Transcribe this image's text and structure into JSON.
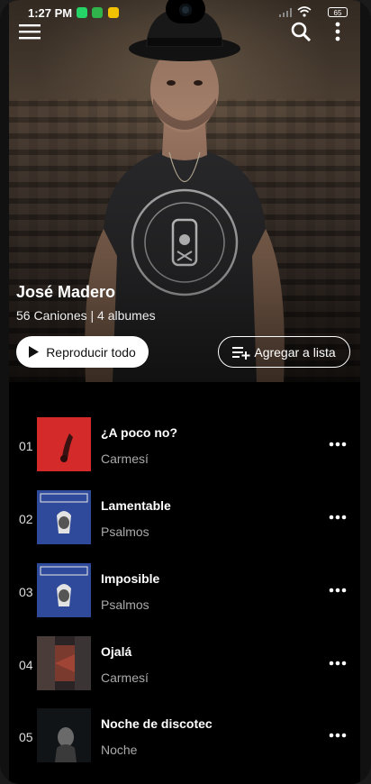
{
  "status_bar": {
    "time": "1:27 PM",
    "battery": "65"
  },
  "artist": {
    "name": "José Madero",
    "meta": "56 Caniones | 4 albumes"
  },
  "actions": {
    "play_all_label": "Reproducir todo",
    "add_to_list_label": "Agregar a lista"
  },
  "icons": {
    "menu": "hamburger-menu-icon",
    "search": "search-icon",
    "overflow": "more-vertical-icon",
    "play": "play-icon",
    "playlist_add": "playlist-add-icon",
    "track_more": "more-horizontal-icon"
  },
  "colors": {
    "accent_red": "#d42a2a",
    "album_psalmos_blue": "#2f4a9a"
  },
  "tracks": [
    {
      "number": "01",
      "title": "¿A poco no?",
      "album": "Carmesí"
    },
    {
      "number": "02",
      "title": "Lamentable",
      "album": "Psalmos"
    },
    {
      "number": "03",
      "title": "Imposible",
      "album": "Psalmos"
    },
    {
      "number": "04",
      "title": "Ojalá",
      "album": "Carmesí"
    },
    {
      "number": "05",
      "title": "Noche de discotec",
      "album": "Noche"
    }
  ]
}
